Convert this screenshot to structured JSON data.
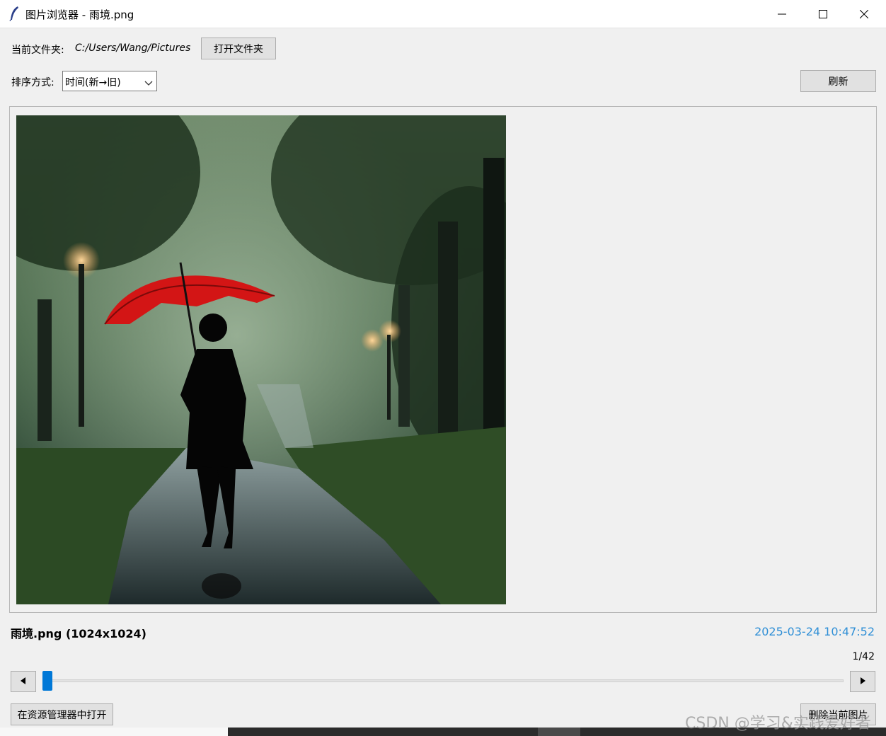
{
  "window": {
    "title": "图片浏览器 - 雨境.png",
    "icon": "feather-icon"
  },
  "toolbar": {
    "folder_label": "当前文件夹:",
    "folder_path": "C:/Users/Wang/Pictures",
    "open_folder_button": "打开文件夹",
    "sort_label": "排序方式:",
    "sort_selected": "时间(新→旧)",
    "refresh_button": "刷新"
  },
  "image": {
    "description_icon": "photo-rain-red-umbrella"
  },
  "info": {
    "file_label": "雨境.png (1024x1024)",
    "timestamp": "2025-03-24 10:47:52",
    "counter": "1/42",
    "current_index": 1,
    "total": 42
  },
  "nav": {
    "prev_icon": "triangle-left-icon",
    "next_icon": "triangle-right-icon"
  },
  "actions": {
    "open_in_explorer": "在资源管理器中打开",
    "delete_current": "删除当前图片"
  },
  "watermark": "CSDN @学习&实践爱好者",
  "colors": {
    "accent": "#0078d7",
    "timestamp": "#2f8fd6",
    "background": "#f0f0f0"
  }
}
